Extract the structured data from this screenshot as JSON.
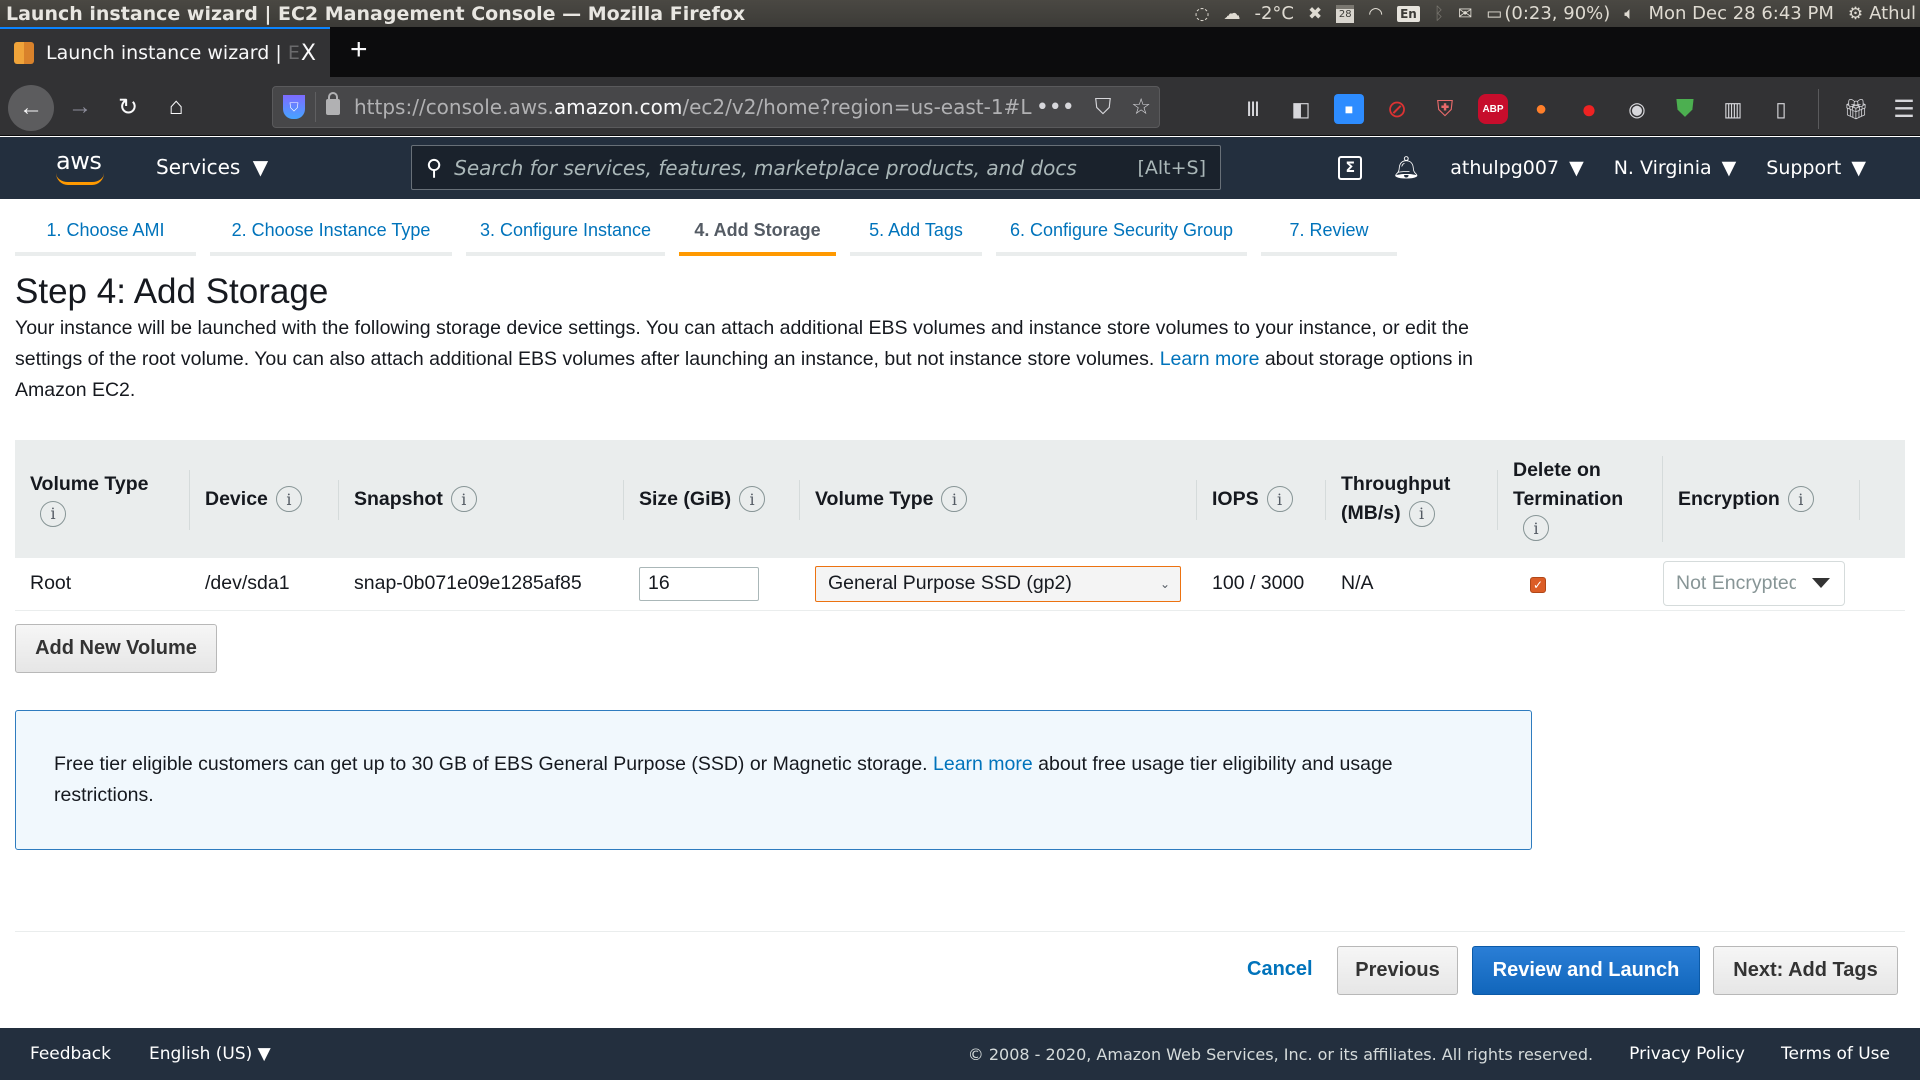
{
  "os": {
    "window_title": "Launch instance wizard | EC2 Management Console — Mozilla Firefox",
    "weather": "-2°C",
    "calendar_day": "28",
    "keyboard_layout": "En",
    "battery": "(0:23, 90%)",
    "datetime": "Mon Dec 28  6:43 PM",
    "user": "Athul"
  },
  "browser": {
    "tab_title": "Launch instance wizard | E",
    "tab_title_faded": "E",
    "tab_title_main": "Launch instance wizard | ",
    "close_glyph": "X",
    "new_tab_glyph": "+",
    "url_prefix": "https://console.aws.",
    "url_domain": "amazon.com",
    "url_suffix": "/ec2/v2/home?region=us-east-1#L",
    "toolbar_icons": [
      "library-icon",
      "sidebar-icon",
      "zoom-icon",
      "blocker-icon",
      "shield-icon",
      "adblock-plus-icon",
      "toggle-icon",
      "tomato-icon",
      "account-icon",
      "adguard-icon",
      "fence-icon",
      "reader-icon",
      "gift-icon",
      "menu-icon"
    ]
  },
  "aws_header": {
    "logo": "aws",
    "services_label": "Services",
    "search_placeholder": "Search for services, features, marketplace products, and docs",
    "search_shortcut": "[Alt+S]",
    "account": "athulpg007",
    "region": "N. Virginia",
    "support": "Support"
  },
  "wizard": {
    "steps": [
      {
        "label": "1. Choose AMI",
        "active": false
      },
      {
        "label": "2. Choose Instance Type",
        "active": false
      },
      {
        "label": "3. Configure Instance",
        "active": false
      },
      {
        "label": "4. Add Storage",
        "active": true
      },
      {
        "label": "5. Add Tags",
        "active": false
      },
      {
        "label": "6. Configure Security Group",
        "active": false
      },
      {
        "label": "7. Review",
        "active": false
      }
    ]
  },
  "main": {
    "title": "Step 4: Add Storage",
    "intro_before_link": "Your instance will be launched with the following storage device settings. You can attach additional EBS volumes and instance store volumes to your instance, or edit the settings of the root volume. You can also attach additional EBS volumes after launching an instance, but not instance store volumes. ",
    "intro_link": "Learn more",
    "intro_after_link": " about storage options in Amazon EC2."
  },
  "table": {
    "headers": [
      {
        "label": "Volume Type",
        "info": true
      },
      {
        "label": "Device",
        "info": true
      },
      {
        "label": "Snapshot",
        "info": true
      },
      {
        "label": "Size (GiB)",
        "info": true
      },
      {
        "label": "Volume Type",
        "info": true
      },
      {
        "label": "IOPS",
        "info": true
      },
      {
        "label": "Throughput (MB/s)",
        "info": true
      },
      {
        "label": "Delete on Termination",
        "info": true
      },
      {
        "label": "Encryption",
        "info": true
      }
    ],
    "rows": [
      {
        "volume_type": "Root",
        "device": "/dev/sda1",
        "snapshot": "snap-0b071e09e1285af85",
        "size_gib": "16",
        "ebs_volume_type": "General Purpose SSD (gp2)",
        "iops": "100 / 3000",
        "throughput": "N/A",
        "delete_on_termination": true,
        "encryption": "Not Encrypted"
      }
    ]
  },
  "add_volume_label": "Add New Volume",
  "free_tier": {
    "text_before_link": "Free tier eligible customers can get up to 30 GB of EBS General Purpose (SSD) or Magnetic storage. ",
    "link": "Learn more",
    "text_after_link": " about free usage tier eligibility and usage restrictions."
  },
  "actions": {
    "cancel": "Cancel",
    "previous": "Previous",
    "review_and_launch": "Review and Launch",
    "next": "Next: Add Tags"
  },
  "footer": {
    "feedback": "Feedback",
    "language": "English (US)",
    "copyright": "© 2008 - 2020, Amazon Web Services, Inc. or its affiliates. All rights reserved.",
    "privacy": "Privacy Policy",
    "terms": "Terms of Use"
  },
  "colors": {
    "aws_header": "#232f3e",
    "link_blue": "#0073bb",
    "active_tab_orange": "#ff9900",
    "primary_button": "#1166bb",
    "checkbox_orange": "#dc5d26"
  }
}
